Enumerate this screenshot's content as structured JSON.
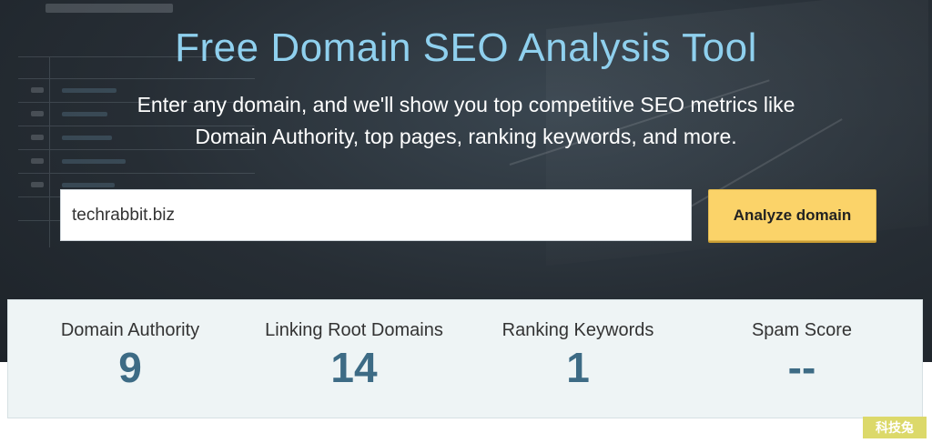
{
  "hero": {
    "title": "Free Domain SEO Analysis Tool",
    "subtitle_line1": "Enter any domain, and we'll show you top competitive SEO metrics like",
    "subtitle_line2": "Domain Authority, top pages, ranking keywords, and more."
  },
  "search": {
    "value": "techrabbit.biz",
    "button_label": "Analyze domain"
  },
  "metrics": [
    {
      "label": "Domain Authority",
      "value": "9"
    },
    {
      "label": "Linking Root Domains",
      "value": "14"
    },
    {
      "label": "Ranking Keywords",
      "value": "1"
    },
    {
      "label": "Spam Score",
      "value": "--"
    }
  ],
  "watermark": "科技兔",
  "colors": {
    "title": "#8fd0ee",
    "button": "#fbd369",
    "metric_value": "#3d6b85",
    "metrics_bg": "#eef4f5"
  }
}
